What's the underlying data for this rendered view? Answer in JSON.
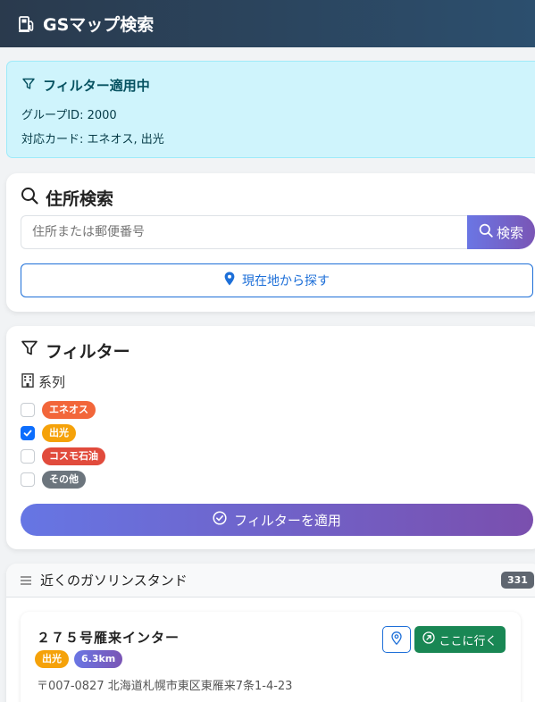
{
  "header": {
    "title": "GSマップ検索",
    "icon": "gas-pump-icon"
  },
  "alert": {
    "title": "フィルター適用中",
    "group": "グループID: 2000",
    "cards": "対応カード: エネオス, 出光"
  },
  "search": {
    "title": "住所検索",
    "placeholder": "住所または郵便番号",
    "button": "検索",
    "locate_button": "現在地から探す"
  },
  "filter": {
    "title": "フィルター",
    "section": "系列",
    "options": [
      {
        "label": "エネオス",
        "checked": false,
        "color": "#f2663a"
      },
      {
        "label": "出光",
        "checked": true,
        "color": "#f5a20a"
      },
      {
        "label": "コスモ石油",
        "checked": false,
        "color": "#e14b3c"
      },
      {
        "label": "その他",
        "checked": false,
        "color": "#6c757d"
      }
    ],
    "apply_button": "フィルターを適用"
  },
  "list": {
    "title": "近くのガソリンスタンド",
    "count": "331",
    "items": [
      {
        "name": "２７５号雁来インター",
        "brand": "出光",
        "brand_color": "#f5a20a",
        "distance": "6.3km",
        "address": "〒007-0827 北海道札幌市東区東雁来7条1-4-23",
        "go_button": "ここに行く"
      }
    ]
  },
  "colors": {
    "header_start": "#2a3a4d",
    "header_end": "#2c4f6e",
    "primary": "#1d6fd8",
    "success": "#198754",
    "info_bg": "#cff4fc"
  }
}
